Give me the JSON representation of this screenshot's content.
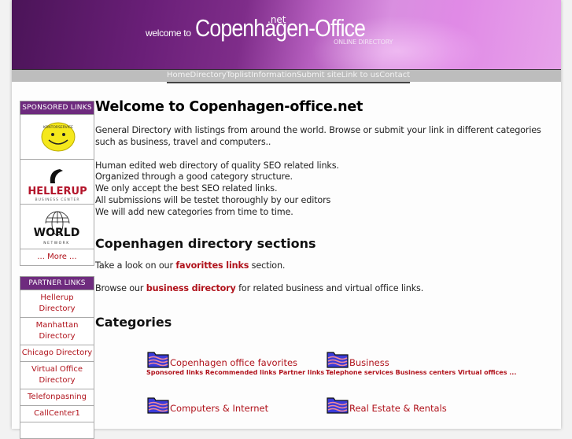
{
  "banner": {
    "welcome": "welcome to",
    "title": "Copenhagen-Office",
    "tld": ".net",
    "subtitle": "ONLINE DIRECTORY"
  },
  "nav": [
    "Home",
    "Directory",
    "Toplist",
    "Information",
    "Submit site",
    "Link to us",
    "Contact"
  ],
  "sidebar": {
    "sponsored_heading": "SPONSORED LINKS",
    "sponsored_logos": [
      {
        "name": "kontorservice-logo",
        "text": "KONTORSERVICE"
      },
      {
        "name": "hellerup-logo",
        "text": "HELLERUP",
        "subtext": "BUSINESS CENTER"
      },
      {
        "name": "world-network-logo",
        "text": "WORLD",
        "subtext": "NETWORK"
      }
    ],
    "more_label": "... More ...",
    "partner_heading": "PARTNER LINKS",
    "partner_links": [
      "Hellerup Directory",
      "Manhattan Directory",
      "Chicago Directory",
      "Virtual Office Directory",
      "Telefonpasning",
      "CallCenter1"
    ]
  },
  "main": {
    "title": "Welcome to Copenhagen-office.net",
    "intro": "General Directory with listings from around the world. Browse or submit your link in different categories such as business, travel and computers..",
    "lines": [
      "Human edited web directory of quality SEO related links.",
      "Organized through a good category structure.",
      "We only accept the best SEO related links.",
      "All submissions will be testet thoroughly by our editors",
      "We will add new categories from time to time."
    ],
    "sections_heading": "Copenhagen directory sections",
    "sections_line1": {
      "before": "Take a look on our ",
      "link": "favorittes links",
      "after": " section."
    },
    "sections_line2": {
      "before": "Browse our ",
      "link": "business directory",
      "after": " for related business and virtual office links."
    },
    "categories_heading": "Categories",
    "categories": [
      {
        "title": "Copenhagen office favorites",
        "sub": "Sponsored links Recommended links Partner links ..."
      },
      {
        "title": "Business",
        "sub": "Telephone services Business centers Virtual offices ..."
      },
      {
        "title": "Computers & Internet",
        "sub": ""
      },
      {
        "title": "Real Estate & Rentals",
        "sub": ""
      }
    ]
  },
  "colors": {
    "accent_purple": "#6e2b7e",
    "link_red": "#b0121b"
  }
}
